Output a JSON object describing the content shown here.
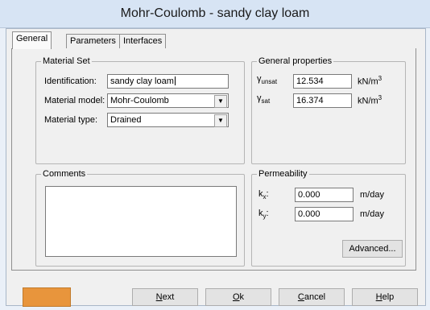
{
  "window": {
    "title": "Mohr-Coulomb - sandy clay loam"
  },
  "tabs": [
    {
      "label": "General",
      "active": true
    },
    {
      "label": "Parameters",
      "active": false
    },
    {
      "label": "Interfaces",
      "active": false
    }
  ],
  "material_set": {
    "legend": "Material Set",
    "identification_label": "Identification:",
    "identification_value": "sandy clay loam",
    "model_label": "Material model:",
    "model_value": "Mohr-Coulomb",
    "type_label": "Material type:",
    "type_value": "Drained"
  },
  "general_properties": {
    "legend": "General properties",
    "gamma_unsat": {
      "symbol": "γ",
      "sub": "unsat",
      "value": "12.534",
      "unit": "kN/m",
      "unit_sup": "3"
    },
    "gamma_sat": {
      "symbol": "γ",
      "sub": "sat",
      "value": "16.374",
      "unit": "kN/m",
      "unit_sup": "3"
    }
  },
  "comments": {
    "legend": "Comments",
    "value": ""
  },
  "permeability": {
    "legend": "Permeability",
    "kx": {
      "symbol": "k",
      "sub": "x",
      "colon": ":",
      "value": "0.000",
      "unit": "m/day"
    },
    "ky": {
      "symbol": "k",
      "sub": "y",
      "colon": ":",
      "value": "0.000",
      "unit": "m/day"
    },
    "advanced_label": "Advanced..."
  },
  "footer": {
    "accent_color": "#e8953c",
    "next": {
      "mnemonic": "N",
      "rest": "ext"
    },
    "ok": {
      "mnemonic": "O",
      "rest": "k"
    },
    "cancel": {
      "mnemonic": "C",
      "rest": "ancel"
    },
    "help": {
      "mnemonic": "H",
      "rest": "elp"
    }
  },
  "icons": {
    "dropdown": "chevron-down-icon"
  }
}
